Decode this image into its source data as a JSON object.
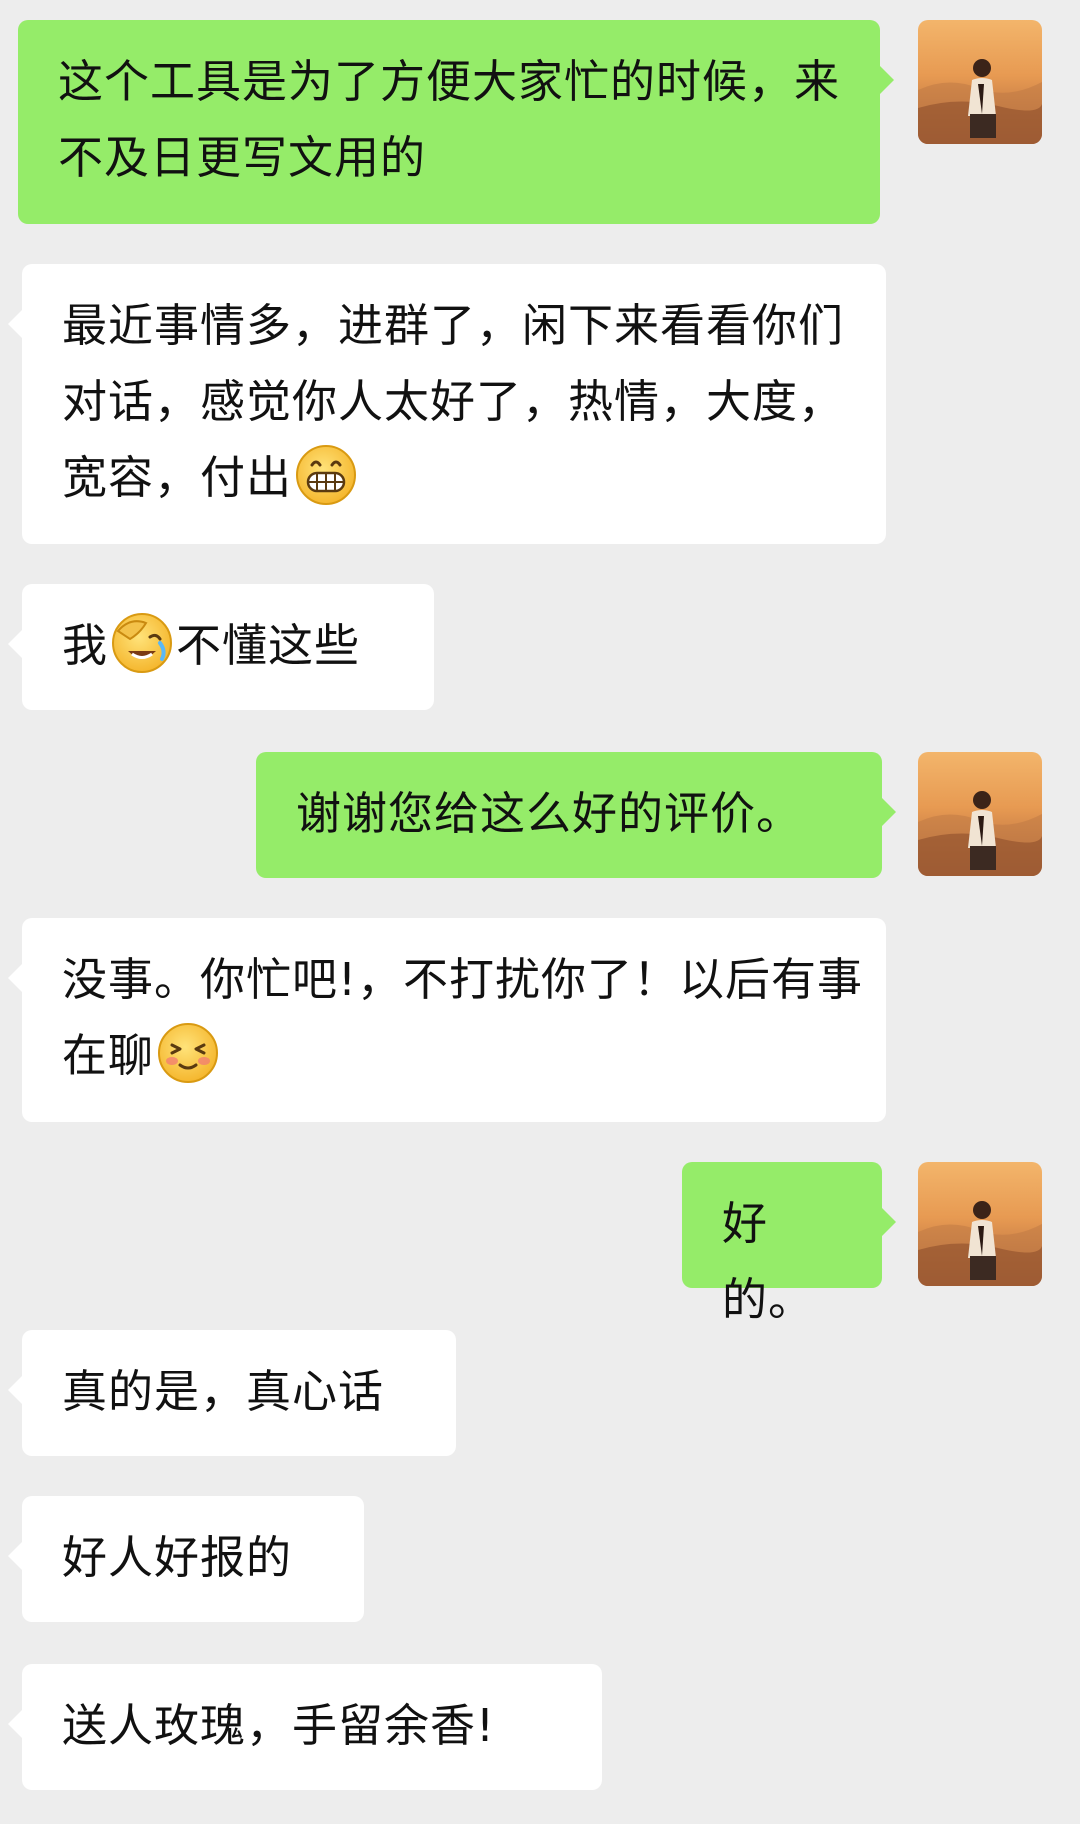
{
  "messages": [
    {
      "side": "out",
      "parts": [
        {
          "text": "这个工具是为了方便大家忙的时候，来不及日更写文用的"
        }
      ]
    },
    {
      "side": "in",
      "parts": [
        {
          "text": "最近事情多，进群了，闲下来看看你们对话，感觉你人太好了，热情，大度，宽容，付出"
        },
        {
          "emoji": "grin-emoji"
        }
      ]
    },
    {
      "side": "in",
      "parts": [
        {
          "text": "我"
        },
        {
          "emoji": "facepalm-laugh-emoji"
        },
        {
          "text": "不懂这些"
        }
      ]
    },
    {
      "side": "out",
      "parts": [
        {
          "text": "谢谢您给这么好的评价。"
        }
      ]
    },
    {
      "side": "in",
      "parts": [
        {
          "text": "没事。你忙吧!，不打扰你了！以后有事在聊"
        },
        {
          "emoji": "shy-smile-emoji"
        }
      ]
    },
    {
      "side": "out",
      "parts": [
        {
          "text": "好的。"
        }
      ]
    },
    {
      "side": "in",
      "parts": [
        {
          "text": "真的是，真心话"
        }
      ]
    },
    {
      "side": "in",
      "parts": [
        {
          "text": "好人好报的"
        }
      ]
    },
    {
      "side": "in",
      "parts": [
        {
          "text": "送人玫瑰，手留余香!"
        }
      ]
    }
  ],
  "colors": {
    "background": "#ededed",
    "bubble_in": "#ffffff",
    "bubble_out": "#95ec69",
    "text": "#111111"
  },
  "icons": {
    "avatar": "user-avatar-sunset-portrait",
    "emojis": [
      "grin-emoji",
      "facepalm-laugh-emoji",
      "shy-smile-emoji"
    ]
  }
}
